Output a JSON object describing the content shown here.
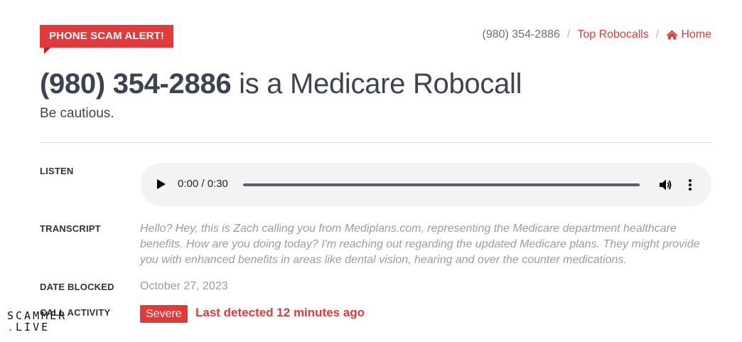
{
  "alert": {
    "label": "PHONE SCAM ALERT!"
  },
  "breadcrumb": {
    "current": "(980) 354-2886",
    "separator": "/",
    "top_robocalls": "Top Robocalls",
    "home": "Home"
  },
  "heading": {
    "number": "(980) 354-2886",
    "rest": " is a Medicare Robocall",
    "subtitle": "Be cautious."
  },
  "details": {
    "listen_label": "LISTEN",
    "player": {
      "time": "0:00 / 0:30"
    },
    "transcript_label": "TRANSCRIPT",
    "transcript": "Hello? Hey, this is Zach calling you from Mediplans.com, representing the Medicare department healthcare benefits. How are you doing today? I'm reaching out regarding the updated Medicare plans. They might provide you with enhanced benefits in areas like dental vision, hearing and over the counter medications.",
    "date_label": "DATE BLOCKED",
    "date": "October 27, 2023",
    "activity_label": "CALL ACTIVITY",
    "severity": "Severe",
    "last_detected": "Last detected 12 minutes ago"
  },
  "watermark": {
    "line1": "SCAMMER",
    "line2": "LIVE"
  },
  "colors": {
    "accent": "#e03a3a",
    "text": "#3d4351",
    "muted": "#9a9ca3"
  }
}
